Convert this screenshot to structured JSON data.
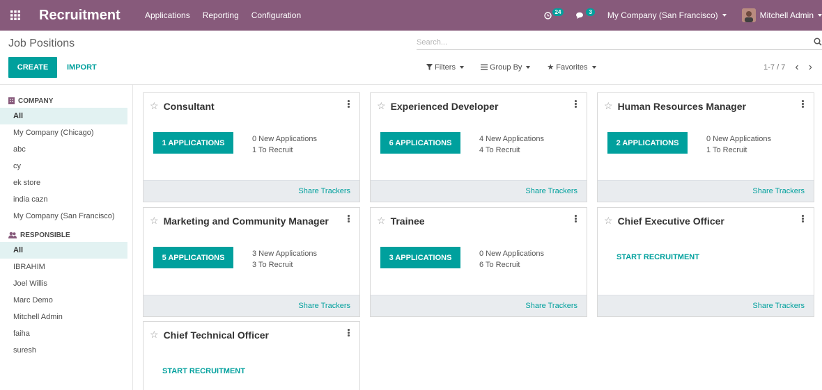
{
  "navbar": {
    "app_title": "Recruitment",
    "menu": [
      "Applications",
      "Reporting",
      "Configuration"
    ],
    "activity_count": "24",
    "message_count": "3",
    "company": "My Company (San Francisco)",
    "user": "Mitchell Admin",
    "color": "#875a7b"
  },
  "control_panel": {
    "breadcrumb": "Job Positions",
    "create_label": "CREATE",
    "import_label": "IMPORT",
    "search_placeholder": "Search...",
    "filters_label": "Filters",
    "groupby_label": "Group By",
    "favorites_label": "Favorites",
    "pager": "1-7 / 7"
  },
  "sidebar": {
    "company_title": "COMPANY",
    "company_items": [
      "All",
      "My Company (Chicago)",
      "abc",
      "cy",
      "ek store",
      "india cazn",
      "My Company (San Francisco)"
    ],
    "responsible_title": "RESPONSIBLE",
    "responsible_items": [
      "All",
      "IBRAHIM",
      "Joel Willis",
      "Marc Demo",
      "Mitchell Admin",
      "faiha",
      "suresh"
    ]
  },
  "cards": [
    {
      "title": "Consultant",
      "applications": "1 APPLICATIONS",
      "new": "0 New Applications",
      "to_recruit": "1 To Recruit",
      "footer": "Share Trackers"
    },
    {
      "title": "Experienced Developer",
      "applications": "6 APPLICATIONS",
      "new": "4 New Applications",
      "to_recruit": "4 To Recruit",
      "footer": "Share Trackers"
    },
    {
      "title": "Human Resources Manager",
      "applications": "2 APPLICATIONS",
      "new": "0 New Applications",
      "to_recruit": "1 To Recruit",
      "footer": "Share Trackers"
    },
    {
      "title": "Marketing and Community Manager",
      "applications": "5 APPLICATIONS",
      "new": "3 New Applications",
      "to_recruit": "3 To Recruit",
      "footer": "Share Trackers"
    },
    {
      "title": "Trainee",
      "applications": "3 APPLICATIONS",
      "new": "0 New Applications",
      "to_recruit": "6 To Recruit",
      "footer": "Share Trackers"
    },
    {
      "title": "Chief Executive Officer",
      "start": "START RECRUITMENT",
      "footer": "Share Trackers"
    },
    {
      "title": "Chief Technical Officer",
      "start": "START RECRUITMENT"
    }
  ],
  "colors": {
    "accent": "#00a09d",
    "active_bg": "#e2f2f2",
    "footer_bg": "#e9ecef"
  }
}
